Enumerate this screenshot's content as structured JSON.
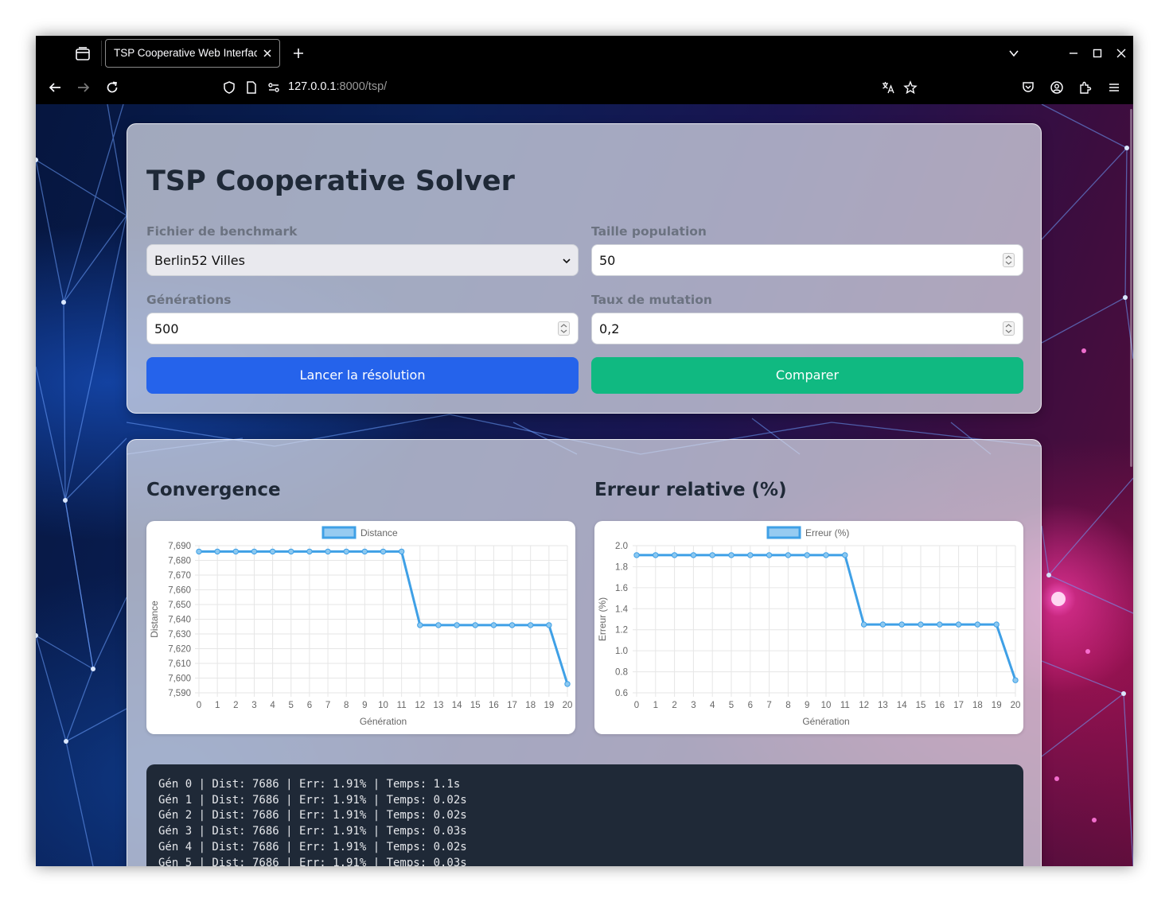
{
  "browser": {
    "tab_title": "TSP Cooperative Web Interface",
    "url_host": "127.0.0.1",
    "url_path": ":8000/tsp/"
  },
  "form": {
    "title": "TSP Cooperative Solver",
    "benchmark_label": "Fichier de benchmark",
    "benchmark_value": "Berlin52 Villes",
    "population_label": "Taille population",
    "population_value": "50",
    "generations_label": "Générations",
    "generations_value": "500",
    "mutation_label": "Taux de mutation",
    "mutation_value": "0,2",
    "run_button": "Lancer la résolution",
    "compare_button": "Comparer"
  },
  "results": {
    "convergence_title": "Convergence",
    "error_title": "Erreur relative (%)"
  },
  "chart_data": [
    {
      "type": "line",
      "legend": "Distance",
      "xlabel": "Génération",
      "ylabel": "Distance",
      "x": [
        0,
        1,
        2,
        3,
        4,
        5,
        6,
        7,
        8,
        9,
        10,
        11,
        12,
        13,
        14,
        15,
        16,
        17,
        18,
        19,
        20
      ],
      "values": [
        7686,
        7686,
        7686,
        7686,
        7686,
        7686,
        7686,
        7686,
        7686,
        7686,
        7686,
        7686,
        7636,
        7636,
        7636,
        7636,
        7636,
        7636,
        7636,
        7636,
        7596
      ],
      "ylim": [
        7590,
        7690
      ],
      "yticks": [
        7690,
        7680,
        7670,
        7660,
        7650,
        7640,
        7630,
        7620,
        7610,
        7600,
        7590
      ],
      "ytick_labels": [
        "7,690",
        "7,680",
        "7,670",
        "7,660",
        "7,650",
        "7,640",
        "7,630",
        "7,620",
        "7,610",
        "7,600",
        "7,590"
      ],
      "color": "#3fa0e6"
    },
    {
      "type": "line",
      "legend": "Erreur (%)",
      "xlabel": "Génération",
      "ylabel": "Erreur (%)",
      "x": [
        0,
        1,
        2,
        3,
        4,
        5,
        6,
        7,
        8,
        9,
        10,
        11,
        12,
        13,
        14,
        15,
        16,
        17,
        18,
        19,
        20
      ],
      "values": [
        1.91,
        1.91,
        1.91,
        1.91,
        1.91,
        1.91,
        1.91,
        1.91,
        1.91,
        1.91,
        1.91,
        1.91,
        1.25,
        1.25,
        1.25,
        1.25,
        1.25,
        1.25,
        1.25,
        1.25,
        0.72
      ],
      "ylim": [
        0.6,
        2.0
      ],
      "yticks": [
        2.0,
        1.8,
        1.6,
        1.4,
        1.2,
        1.0,
        0.8,
        0.6
      ],
      "ytick_labels": [
        "2.0",
        "1.8",
        "1.6",
        "1.4",
        "1.2",
        "1.0",
        "0.8",
        "0.6"
      ],
      "color": "#3fa0e6"
    }
  ],
  "log_lines": [
    "Gén 0 | Dist: 7686 | Err: 1.91% | Temps: 1.1s",
    "Gén 1 | Dist: 7686 | Err: 1.91% | Temps: 0.02s",
    "Gén 2 | Dist: 7686 | Err: 1.91% | Temps: 0.02s",
    "Gén 3 | Dist: 7686 | Err: 1.91% | Temps: 0.03s",
    "Gén 4 | Dist: 7686 | Err: 1.91% | Temps: 0.02s",
    "Gén 5 | Dist: 7686 | Err: 1.91% | Temps: 0.03s"
  ],
  "icons": {
    "tab_list": "tab-list-icon",
    "back": "back-arrow-icon",
    "forward": "forward-arrow-icon",
    "reload": "reload-icon",
    "shield": "shield-icon",
    "page": "page-icon",
    "permissions": "permissions-icon",
    "translate": "translate-icon",
    "bookmark": "star-icon",
    "pocket": "pocket-icon",
    "account": "account-icon",
    "extensions": "extensions-icon",
    "menu": "menu-icon"
  }
}
